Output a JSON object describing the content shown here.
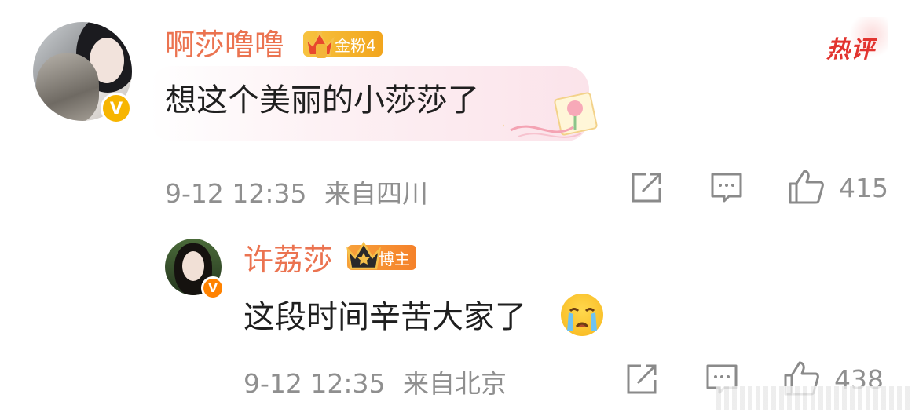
{
  "main_comment": {
    "username": "啊莎噜噜",
    "fan_badge": "金粉4",
    "hot_label": "热评",
    "text": "想这个美丽的小莎莎了",
    "timestamp": "9-12 12:35",
    "location": "来自四川",
    "like_count": "415",
    "verified_mark": "V"
  },
  "reply": {
    "username": "许荔莎",
    "host_badge": "博主",
    "text": "这段时间辛苦大家了",
    "timestamp": "9-12 12:35",
    "location": "来自北京",
    "like_count": "438",
    "verified_mark": "V",
    "emoji": "crying-face"
  },
  "colors": {
    "username": "#eb7350",
    "meta": "#8f8f8f",
    "hot": "#e2342f",
    "badge_gold": "#f7b500",
    "badge_orange": "#ff8200"
  },
  "icons": [
    "share-icon",
    "comment-icon",
    "like-icon",
    "crown-icon",
    "verified-icon"
  ]
}
